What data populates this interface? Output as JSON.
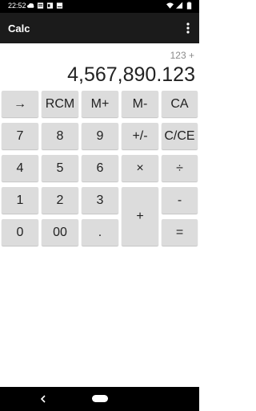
{
  "status_bar": {
    "time": "22:52",
    "left_icons": [
      "cloud-icon",
      "notification-icon",
      "notification-icon",
      "notification-icon"
    ],
    "right_icons": [
      "wifi-icon",
      "signal-icon",
      "battery-icon"
    ]
  },
  "app_bar": {
    "title": "Calc",
    "menu_icon": "more-vert-icon"
  },
  "display": {
    "expression": "123 +",
    "value": "4,567,890.123"
  },
  "keys": {
    "arrow": "→",
    "rcm": "RCM",
    "m_plus": "M+",
    "m_minus": "M-",
    "ca": "CA",
    "seven": "7",
    "eight": "8",
    "nine": "9",
    "plus_minus": "+/-",
    "c_ce": "C/CE",
    "four": "4",
    "five": "5",
    "six": "6",
    "multiply": "×",
    "divide": "÷",
    "one": "1",
    "two": "2",
    "three": "3",
    "plus": "+",
    "minus": "-",
    "zero": "0",
    "double_zero": "00",
    "decimal": ".",
    "equals": "="
  },
  "colors": {
    "status_bar": "#000000",
    "app_bar": "#1b1b1b",
    "key_bg": "#dcdcdc",
    "background": "#ffffff"
  }
}
